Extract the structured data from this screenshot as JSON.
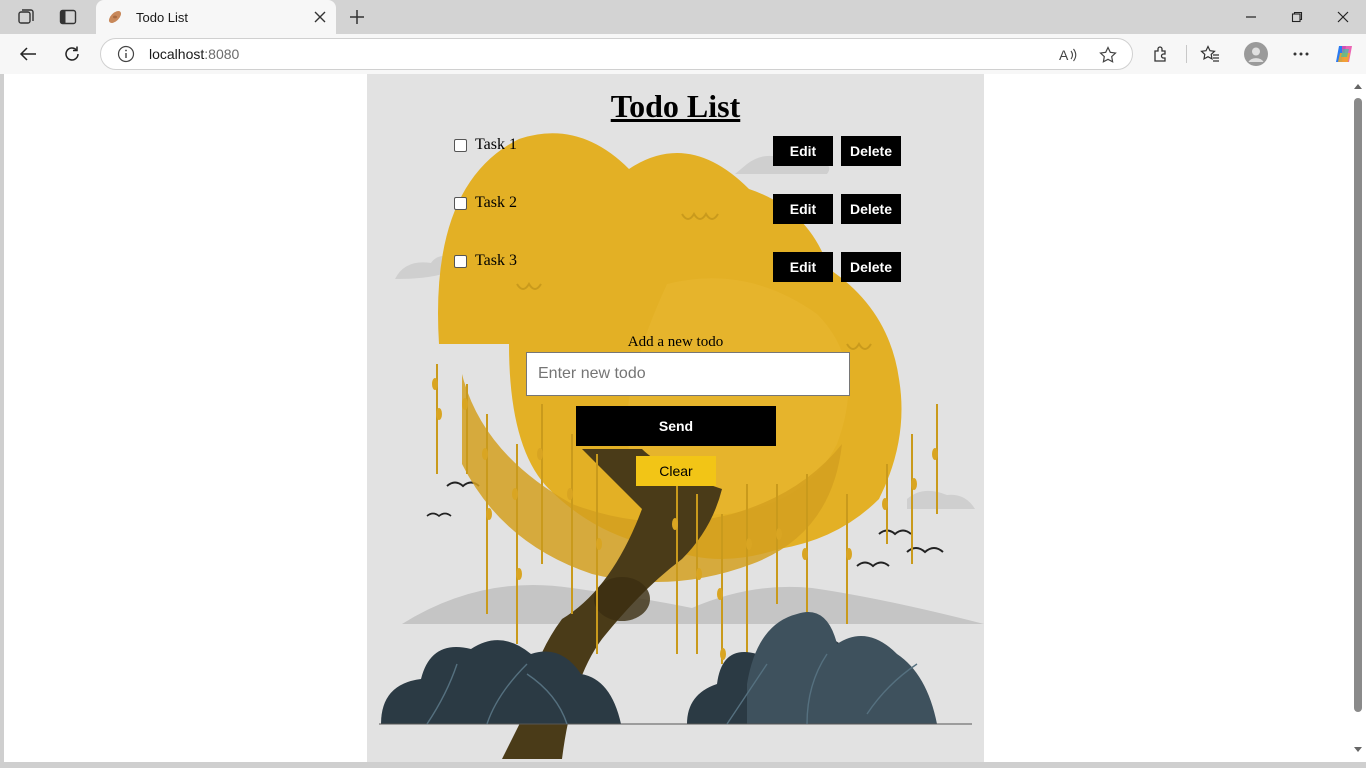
{
  "browser": {
    "tab_title": "Todo List",
    "url_host": "localhost",
    "url_port": ":8080"
  },
  "app": {
    "title": "Todo List",
    "tasks": [
      {
        "label": "Task 1",
        "checked": false,
        "edit_label": "Edit",
        "delete_label": "Delete"
      },
      {
        "label": "Task 2",
        "checked": false,
        "edit_label": "Edit",
        "delete_label": "Delete"
      },
      {
        "label": "Task 3",
        "checked": false,
        "edit_label": "Edit",
        "delete_label": "Delete"
      }
    ],
    "add_label": "Add a new todo",
    "input_value": "",
    "input_placeholder": "Enter new todo",
    "send_label": "Send",
    "clear_label": "Clear"
  },
  "colors": {
    "page_bg": "#e2e2e2",
    "button_black": "#000000",
    "clear_yellow": "#f2c516",
    "tree_yellow": "#e3b025"
  }
}
